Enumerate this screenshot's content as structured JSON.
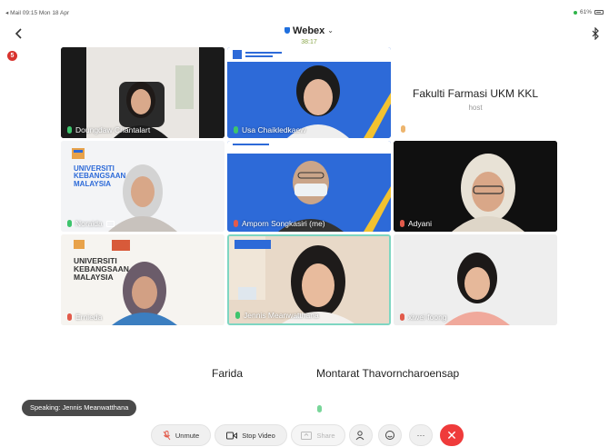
{
  "status_bar": {
    "left": "◂ Mail  09:15  Mon 18 Apr",
    "right": "61%"
  },
  "header": {
    "app_title": "Webex",
    "timer": "38:17",
    "recording_badge": "5"
  },
  "tiles": [
    {
      "name": "Doungdaw Chantalart",
      "mic": "on"
    },
    {
      "name": "Usa Chaikledkaew",
      "mic": "on"
    },
    {
      "name": "Noraida",
      "mic": "on",
      "screen": true
    },
    {
      "name": "Amporn Songkasiri (me)",
      "mic": "off"
    },
    {
      "name": "Adyani",
      "mic": "off"
    },
    {
      "name": "Ernieda",
      "mic": "off"
    },
    {
      "name": "Jennis Meanwatthana",
      "mic": "on"
    },
    {
      "name": "xiwei foong",
      "mic": "off"
    }
  ],
  "tile_text": {
    "noraida_bg": "UNIVERSITI\nKEBANGSAAN\nMALAYSIA",
    "ernieda_bg": "UNIVERSITI\nKEBANGSAAN\nMALAYSIA"
  },
  "audio_participant": {
    "name": "Fakulti Farmasi UKM KKL",
    "role": "host"
  },
  "bottom_participants": [
    "Farida",
    "Montarat Thavorncharoensap"
  ],
  "speaking_indicator": "Speaking: Jennis Meanwatthana",
  "toolbar": {
    "unmute": "Unmute",
    "stop_video": "Stop Video",
    "share": "Share",
    "more": "···",
    "end": "✕"
  },
  "colors": {
    "accent": "#2d6ad8",
    "end_call": "#ef3b3b",
    "mic_on": "#3ec46d",
    "mic_off": "#e25b4b"
  }
}
